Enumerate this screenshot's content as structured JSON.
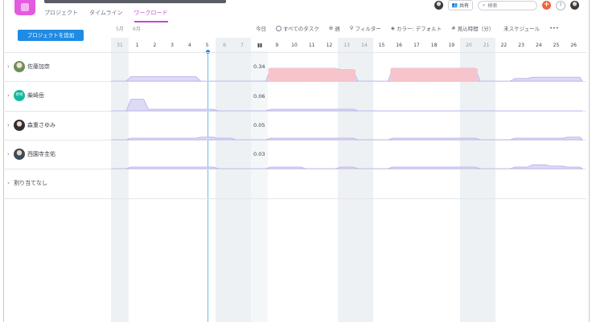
{
  "header": {
    "tabs": [
      {
        "label": "プロジェクト",
        "active": false
      },
      {
        "label": "タイムライン",
        "active": false
      },
      {
        "label": "ワークロード",
        "active": true
      }
    ],
    "share_label": "共有",
    "search_placeholder": "検索",
    "plus_label": "+",
    "help_label": "?"
  },
  "add_project_label": "プロジェクトを追加",
  "toolbar": {
    "today": "今日",
    "all_tasks": "すべてのタスク",
    "week": "週",
    "filter": "フィルター",
    "color": "カラー: デフォルト",
    "estimate": "見込時間（分）",
    "unscheduled": "未スケジュール",
    "more": "•••"
  },
  "months": [
    "5月",
    "6月"
  ],
  "days": [
    "31",
    "1",
    "2",
    "3",
    "4",
    "5",
    "6",
    "7",
    "",
    "9",
    "10",
    "11",
    "12",
    "13",
    "14",
    "15",
    "16",
    "17",
    "18",
    "19",
    "20",
    "21",
    "22",
    "23",
    "24",
    "25",
    "26"
  ],
  "weekend_idx": [
    0,
    6,
    7,
    13,
    14,
    20,
    21
  ],
  "rows": [
    {
      "name": "佐藤加奈",
      "hours": "0.34",
      "avatar": "photo",
      "series_color": "#c7c3f0",
      "over_color": "#f7c4cc"
    },
    {
      "name": "柴崎岳",
      "hours": "0.06",
      "avatar_text": "柴崎",
      "series_color": "#c7c3f0"
    },
    {
      "name": "森重さゆみ",
      "hours": "0.05",
      "avatar": "photo",
      "series_color": "#c7c3f0"
    },
    {
      "name": "西園寺圭佑",
      "hours": "0.03",
      "avatar": "photo",
      "series_color": "#c7c3f0"
    }
  ],
  "unassigned_label": "割り当てなし",
  "workload": [
    [
      0,
      0.35,
      0.35,
      0.35,
      0.35,
      0,
      0,
      0,
      0,
      1,
      1,
      1,
      1,
      0.9,
      0,
      0,
      1,
      1,
      1,
      1,
      1,
      0,
      0,
      0.2,
      0.3,
      0.3,
      0.3
    ],
    [
      0,
      0.9,
      0.1,
      0.1,
      0.1,
      0.1,
      0,
      0,
      0,
      0.1,
      0.1,
      0.1,
      0.1,
      0.1,
      0,
      0,
      0,
      0,
      0,
      0,
      0,
      0,
      0,
      0,
      0,
      0,
      0
    ],
    [
      0,
      0.1,
      0.1,
      0.1,
      0.1,
      0.2,
      0.1,
      0,
      0,
      0.1,
      0.1,
      0.1,
      0.1,
      0.1,
      0,
      0,
      0.1,
      0.1,
      0.1,
      0.1,
      0.1,
      0,
      0,
      0.1,
      0.1,
      0.1,
      0.2
    ],
    [
      0,
      0.1,
      0.1,
      0.1,
      0.1,
      0.1,
      0,
      0,
      0,
      0.1,
      0.1,
      0,
      0,
      0.1,
      0,
      0,
      0.1,
      0.1,
      0.1,
      0.1,
      0.1,
      0,
      0,
      0.1,
      0.3,
      0.2,
      0.1
    ]
  ]
}
